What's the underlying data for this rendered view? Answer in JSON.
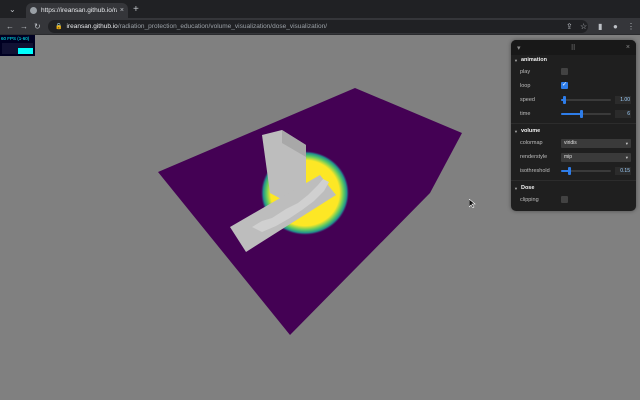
{
  "browser": {
    "tab_title": "https://ireansan.github.io/radia",
    "tab_close": "×",
    "new_tab": "+",
    "back": "←",
    "forward": "→",
    "reload": "↻",
    "url_host": "ireansan.github.io",
    "url_path": "/radiation_protection_education/volume_visualization/dose_visualization/",
    "lock": "🔒",
    "share": "⇪",
    "star": "☆",
    "sidepanel": "▮",
    "profile": "●",
    "menu": "⋮"
  },
  "stats": {
    "label": "60 FPS (1-60)",
    "level": 0.55
  },
  "panel": {
    "collapse": "▾",
    "drag": "⠿",
    "close": "×",
    "folders": [
      {
        "title": "animation",
        "rows": [
          {
            "name": "play",
            "type": "checkbox",
            "checked": false
          },
          {
            "name": "loop",
            "type": "checkbox",
            "checked": true,
            "check": "✓"
          },
          {
            "name": "speed",
            "type": "slider",
            "value": "1.00",
            "fraction": 0.05
          },
          {
            "name": "time",
            "type": "slider",
            "value": "6",
            "fraction": 0.4
          }
        ]
      },
      {
        "title": "volume",
        "rows": [
          {
            "name": "colormap",
            "type": "select",
            "value": "viridis",
            "arrow": "▾"
          },
          {
            "name": "renderstyle",
            "type": "select",
            "value": "mip",
            "arrow": "▾"
          },
          {
            "name": "isothreshold",
            "type": "slider",
            "value": "0.15",
            "fraction": 0.15
          }
        ]
      },
      {
        "title": "Dose",
        "rows": [
          {
            "name": "clipping",
            "type": "checkbox",
            "checked": false
          }
        ]
      }
    ]
  },
  "scene": {
    "background": "#808080",
    "floor_color": "#440154",
    "dose_colors": [
      "#fde725",
      "#5ec962",
      "#21918c"
    ],
    "object_color": "#bdbdbd"
  }
}
